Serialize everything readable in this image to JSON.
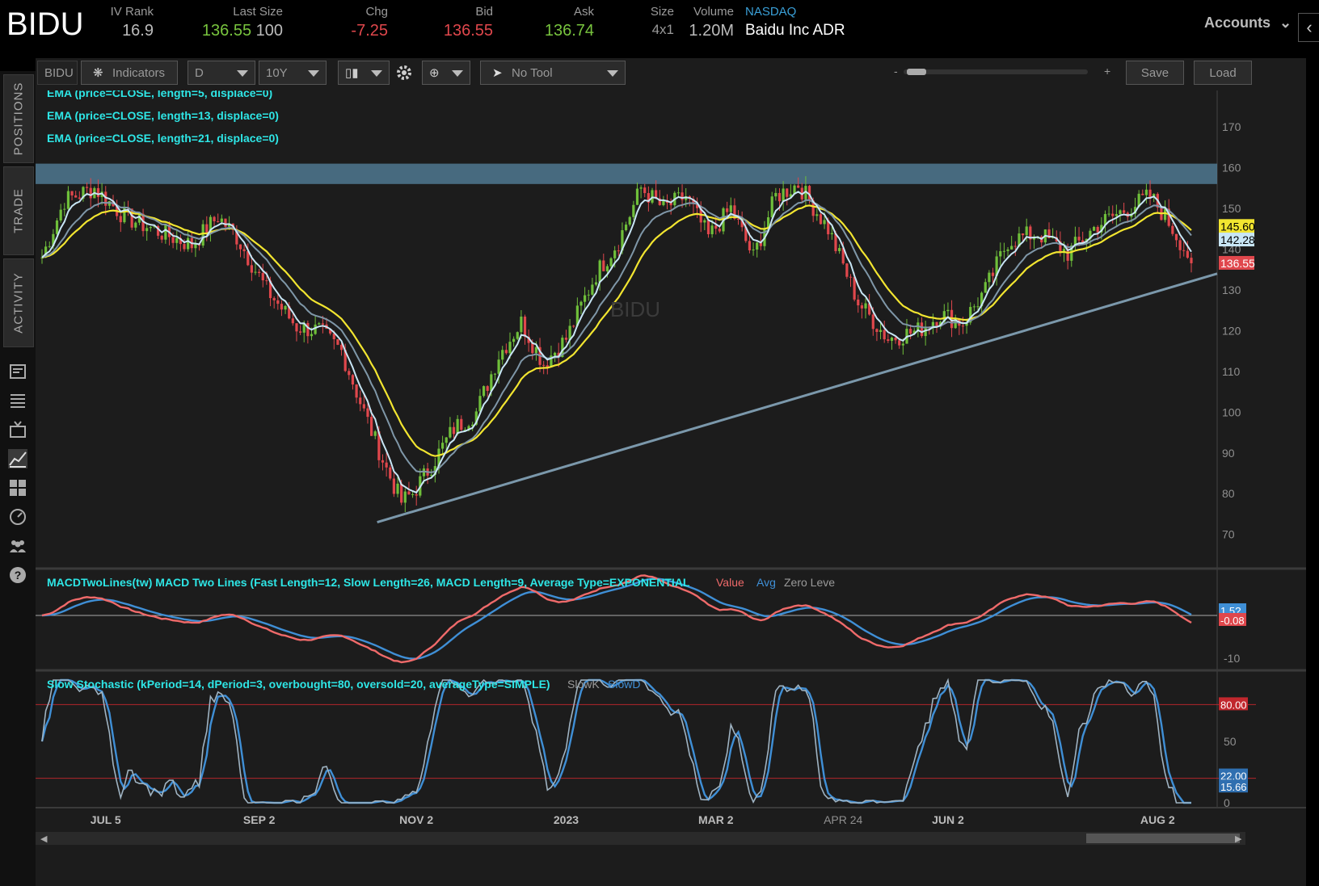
{
  "header": {
    "symbol": "BIDU",
    "iv_rank_label": "IV Rank",
    "iv_rank": "16.9",
    "last_size_label": "Last Size",
    "last_price": "136.55",
    "last_size": "100",
    "chg_label": "Chg",
    "chg": "-7.25",
    "bid_label": "Bid",
    "bid": "136.55",
    "ask_label": "Ask",
    "ask": "136.74",
    "size_label": "Size",
    "size": "4x1",
    "volume_label": "Volume",
    "volume": "1.20M",
    "exchange": "NASDAQ",
    "company": "Baidu Inc ADR",
    "accounts_label": "Accounts"
  },
  "sidebar": {
    "tabs": [
      "POSITIONS",
      "TRADE",
      "ACTIVITY"
    ],
    "icons": [
      "news-icon",
      "list-icon",
      "tv-icon",
      "chart-icon",
      "grid-icon",
      "analyze-icon",
      "community-icon",
      "help-icon"
    ]
  },
  "toolbar": {
    "symbol_field": "BIDU",
    "indicators_label": "Indicators",
    "aggregation": "D",
    "timeframe": "10Y",
    "tool": "No Tool",
    "zoom_minus": "-",
    "zoom_plus": "+",
    "save_label": "Save",
    "load_label": "Load"
  },
  "studies": {
    "ema5": "EMA (price=CLOSE, length=5, displace=0)",
    "ema13": "EMA (price=CLOSE, length=13, displace=0)",
    "ema21": "EMA (price=CLOSE, length=21, displace=0)",
    "macd": "MACDTwoLines(tw) MACD Two Lines (Fast Length=12, Slow Length=26, MACD Length=9, Average Type=EXPONENTIAL",
    "macd_value": "Value",
    "macd_avg": "Avg",
    "macd_zero": "Zero Leve",
    "stoch": "Slow Stochastic (kPeriod=14, dPeriod=3, overbought=80, oversold=20, averageType=SIMPLE)",
    "stoch_k": "SlowK",
    "stoch_d": "SlowD"
  },
  "watermark": "BIDU",
  "colors": {
    "up": "#6fbf3a",
    "down": "#e0474c",
    "ema5": "#c8e6f5",
    "ema13": "#7f97a8",
    "ema21": "#f2e530",
    "macd_value": "#ef6a6a",
    "macd_avg": "#3f8fd6",
    "resistance_band": "#4f7890",
    "trendline": "#7b98ab",
    "study_label": "#2ee6e6"
  },
  "chart_data": {
    "type": "candlestick",
    "price_axis": {
      "ticks": [
        170,
        160,
        150,
        140,
        130,
        120,
        110,
        100,
        90,
        80,
        70
      ],
      "ylim": [
        62,
        175
      ]
    },
    "price_tags": [
      {
        "value": "145.60",
        "bg": "#f2e530",
        "fg": "#000"
      },
      {
        "value": "142.28",
        "bg": "#c8e6f5",
        "fg": "#000"
      },
      {
        "value": "136.55",
        "bg": "#e0474c",
        "fg": "#fff"
      }
    ],
    "x_labels": [
      "JUL 5",
      "SEP 2",
      "NOV 2",
      "2023",
      "MAR 2",
      "APR 24",
      "JUN 2",
      "AUG 2"
    ],
    "resistance_zone": [
      156,
      161
    ],
    "trendline": {
      "from": {
        "date": "2022-10-24",
        "price": 73
      },
      "to": {
        "date": "2023-08-10",
        "price": 134
      }
    },
    "close_path": [
      [
        0,
        138
      ],
      [
        6,
        152
      ],
      [
        14,
        155
      ],
      [
        22,
        148
      ],
      [
        32,
        144
      ],
      [
        40,
        141
      ],
      [
        47,
        148
      ],
      [
        52,
        143
      ],
      [
        60,
        130
      ],
      [
        68,
        121
      ],
      [
        74,
        120
      ],
      [
        80,
        115
      ],
      [
        86,
        100
      ],
      [
        92,
        86
      ],
      [
        96,
        78
      ],
      [
        99,
        80
      ],
      [
        104,
        87
      ],
      [
        110,
        96
      ],
      [
        116,
        100
      ],
      [
        122,
        114
      ],
      [
        128,
        122
      ],
      [
        134,
        112
      ],
      [
        140,
        118
      ],
      [
        148,
        134
      ],
      [
        154,
        142
      ],
      [
        160,
        155
      ],
      [
        166,
        150
      ],
      [
        172,
        153
      ],
      [
        178,
        143
      ],
      [
        184,
        150
      ],
      [
        190,
        138
      ],
      [
        196,
        153
      ],
      [
        202,
        156
      ],
      [
        210,
        145
      ],
      [
        218,
        127
      ],
      [
        226,
        118
      ],
      [
        234,
        120
      ],
      [
        240,
        124
      ],
      [
        246,
        122
      ],
      [
        252,
        130
      ],
      [
        258,
        142
      ],
      [
        266,
        144
      ],
      [
        274,
        139
      ],
      [
        282,
        146
      ],
      [
        290,
        150
      ],
      [
        296,
        153
      ],
      [
        300,
        148
      ],
      [
        304,
        142
      ],
      [
        307,
        137
      ]
    ],
    "ema5_last": 142.28,
    "ema21_last": 145.6,
    "last_close": 136.55,
    "macd": {
      "ticks": [
        "1.5?",
        "-0.08",
        "-10"
      ],
      "value_last": -0.08,
      "zero_line": 0,
      "ylim": [
        -12,
        8
      ]
    },
    "stochastic": {
      "ticks": [
        "80.00",
        "50",
        "22.00",
        "15.66",
        "0"
      ],
      "k_last": 15.66,
      "d_last": 22.0,
      "overbought": 80,
      "oversold": 20
    }
  }
}
